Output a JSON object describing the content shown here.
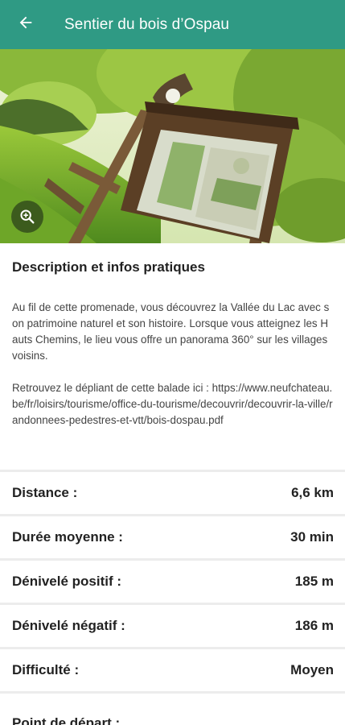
{
  "appbar": {
    "title": "Sentier du bois d’Ospau",
    "back_icon": "arrow-left-icon",
    "background": "#2f9a84"
  },
  "hero": {
    "zoom_icon": "zoom-in-icon"
  },
  "description": {
    "title": "Description et infos pratiques",
    "text": "Au fil de cette promenade, vous découvrez la Vallée du Lac avec son patrimoine naturel et son histoire. Lorsque vous atteignez les Hauts Chemins, le lieu vous offre un panorama 360° sur les villages voisins.\n\nRetrouvez le dépliant de cette balade ici : https://www.neufchateau.be/fr/loisirs/tourisme/office-du-tourisme/decouvrir/decouvrir-la-ville/randonnees-pedestres-et-vtt/bois-dospau.pdf"
  },
  "stats": [
    {
      "label": "Distance :",
      "value": "6,6 km"
    },
    {
      "label": "Durée moyenne :",
      "value": "30 min"
    },
    {
      "label": "Dénivelé positif :",
      "value": "185 m"
    },
    {
      "label": "Dénivelé négatif :",
      "value": "186 m"
    },
    {
      "label": "Difficulté :",
      "value": "Moyen"
    }
  ],
  "start": {
    "label": "Point de départ :"
  }
}
